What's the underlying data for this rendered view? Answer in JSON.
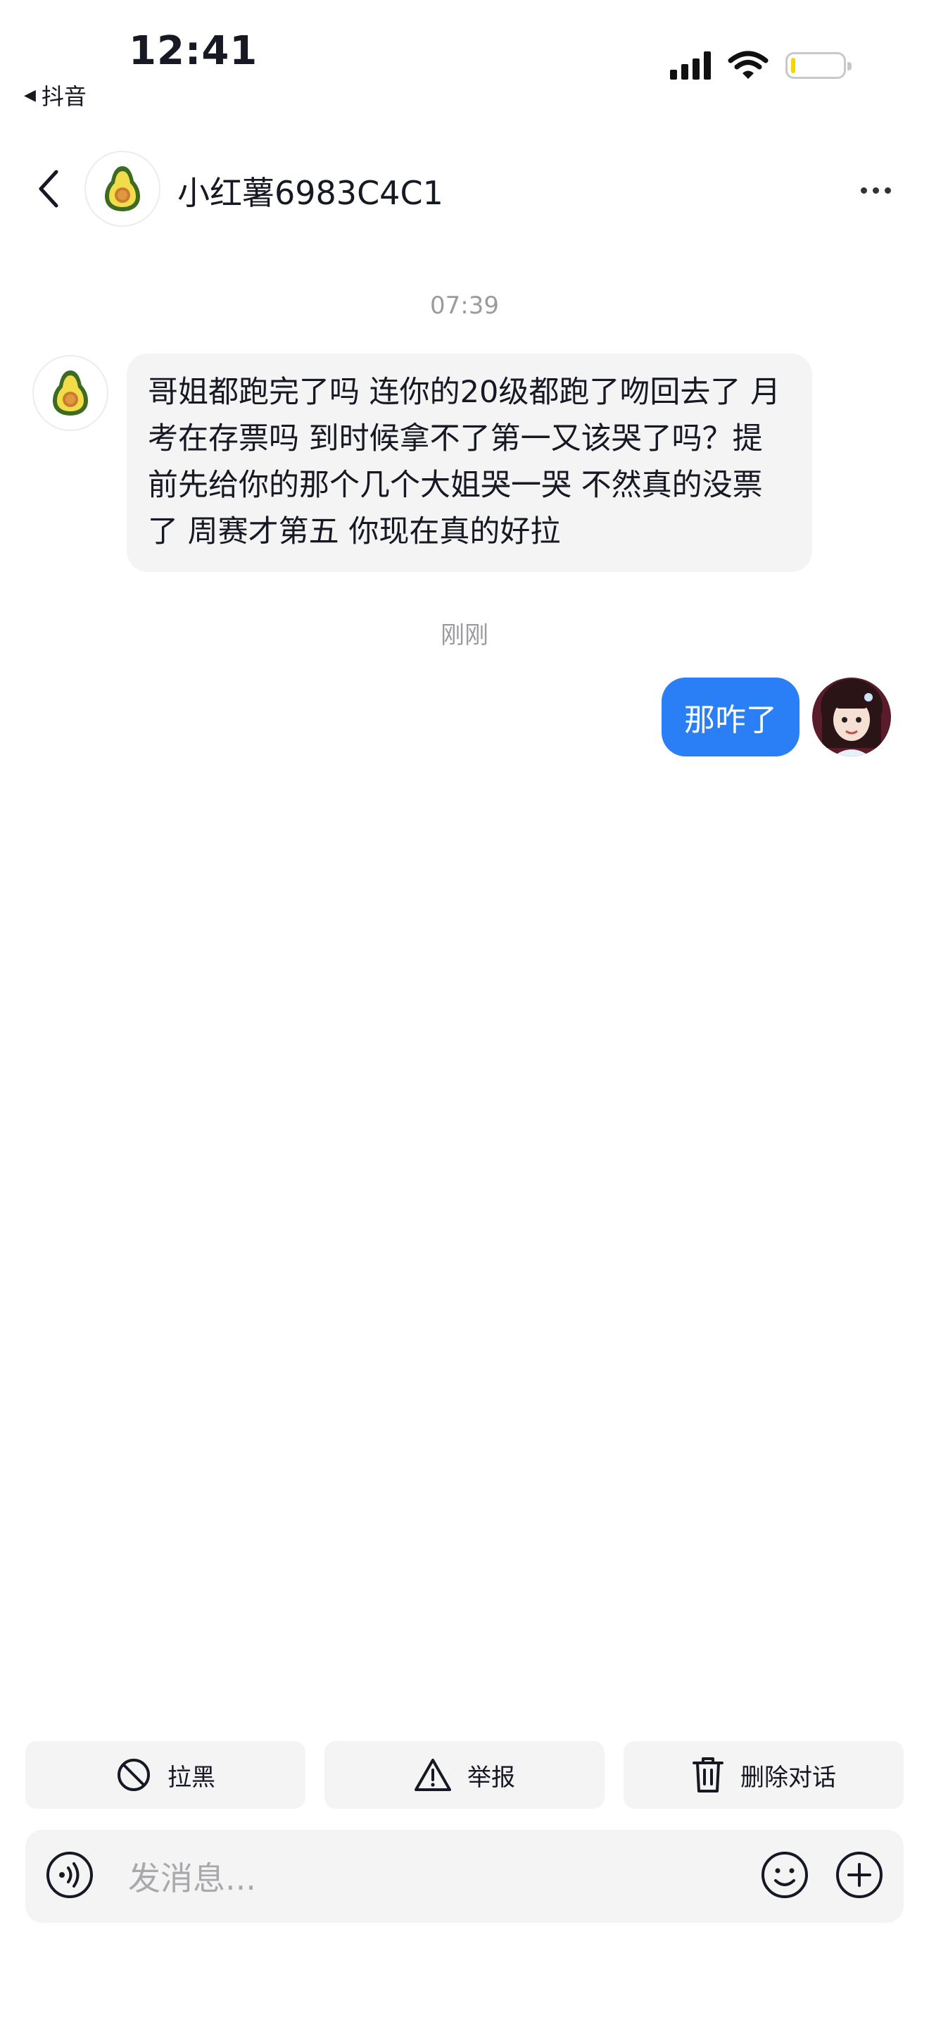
{
  "status_bar": {
    "time": "12:41",
    "back_app": "抖音",
    "back_app_arrow": "◀"
  },
  "header": {
    "contact_name": "小红薯6983C4C1",
    "avatar_icon": "avocado-icon"
  },
  "chat": {
    "timestamp_1": "07:39",
    "incoming_message": "哥姐都跑完了吗 连你的20级都跑了吻回去了 月考在存票吗 到时候拿不了第一又该哭了吗？提前先给你的那个几个大姐哭一哭 不然真的没票了 周赛才第五 你现在真的好拉",
    "timestamp_2": "刚刚",
    "outgoing_message": "那咋了"
  },
  "actions": {
    "block_label": "拉黑",
    "report_label": "举报",
    "delete_label": "删除对话"
  },
  "composer": {
    "placeholder": "发消息..."
  },
  "colors": {
    "accent_blue": "#2b7ff6",
    "bubble_gray": "#f4f4f5",
    "text_dark": "#161823",
    "muted": "#9a9ba0"
  }
}
